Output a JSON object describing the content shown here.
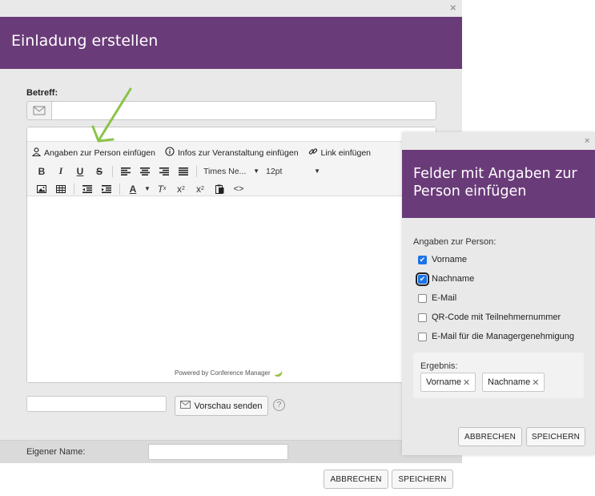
{
  "main": {
    "title": "Einladung erstellen",
    "close": "×",
    "subject_label": "Betreff:",
    "subject_value": "",
    "toolbar": {
      "insert_person": "Angaben zur Person einfügen",
      "insert_event": "Infos zur Veranstaltung einfügen",
      "insert_link": "Link einfügen",
      "font_family": "Times Ne...",
      "font_size": "12pt"
    },
    "powered_by": "Powered by Conference Manager",
    "preview_email": "",
    "preview_button": "Vorschau senden",
    "help": "?",
    "own_name_label": "Eigener Name:",
    "own_name_value": "",
    "cancel": "ABBRECHEN",
    "save": "SPEICHERN"
  },
  "dialog": {
    "title": "Felder mit Angaben zur Person einfügen",
    "close": "×",
    "section_label": "Angaben zur Person:",
    "fields": [
      {
        "label": "Vorname",
        "checked": true
      },
      {
        "label": "Nachname",
        "checked": true
      },
      {
        "label": "E-Mail",
        "checked": false
      },
      {
        "label": "QR-Code mit Teilnehmernummer",
        "checked": false
      },
      {
        "label": "E-Mail für die Managergenehmigung",
        "checked": false
      }
    ],
    "result_label": "Ergebnis:",
    "result_tags": [
      "Vorname",
      "Nachname"
    ],
    "cancel": "ABBRECHEN",
    "save": "SPEICHERN"
  },
  "colors": {
    "header": "#6a3b79",
    "arrow": "#8bc34a",
    "checkbox": "#1a73e8"
  }
}
